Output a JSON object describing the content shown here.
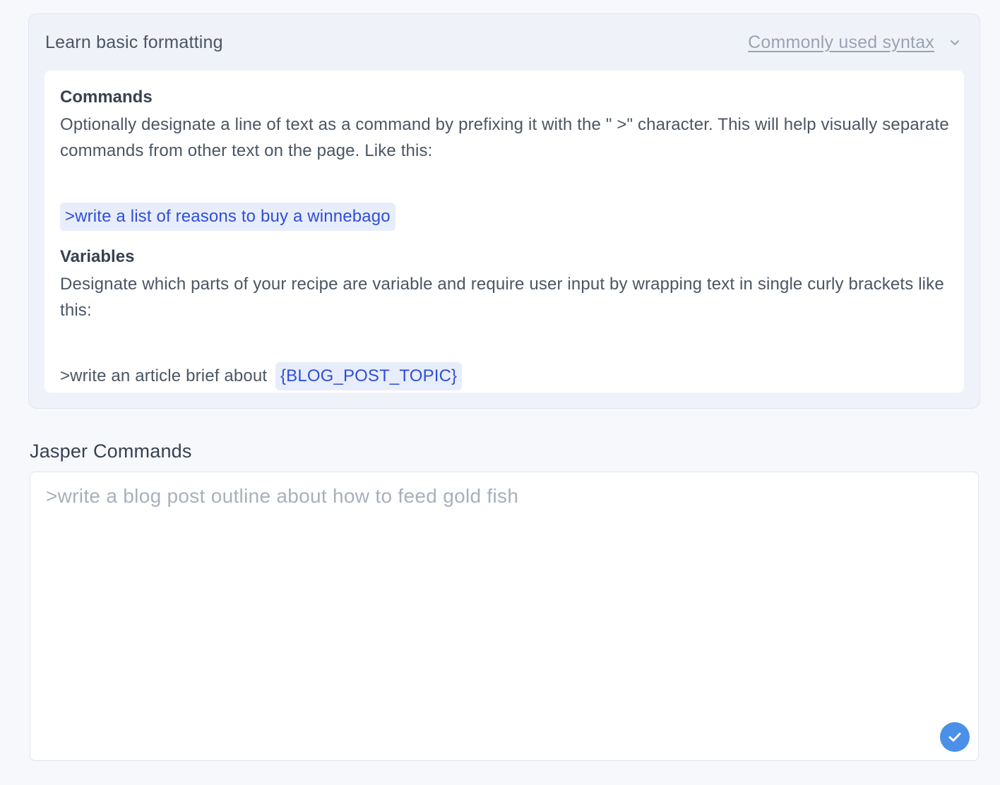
{
  "format_panel": {
    "title": "Learn basic formatting",
    "syntax_link": "Commonly used syntax",
    "toggle_icon": "chevron-down-icon",
    "commands": {
      "heading": "Commands",
      "description": "Optionally designate a line of text as a command by prefixing it with the \" >\" character. This will help visually separate commands from other text on the page. Like this:",
      "example": ">write a list of reasons to buy a winnebago"
    },
    "variables": {
      "heading": "Variables",
      "description": "Designate which parts of your recipe are variable and require user input by wrapping text in single curly brackets like this:",
      "example_prefix": ">write an article brief about",
      "example_variable": "{BLOG_POST_TOPIC}"
    }
  },
  "jasper_commands": {
    "label": "Jasper Commands",
    "placeholder": ">write a blog post outline about how to feed gold fish",
    "value": "",
    "status_icon": "check-circle-icon"
  },
  "colors": {
    "accent": "#2f4fd8",
    "chip_background": "#e8edfb",
    "check_badge": "#4a8fe8"
  }
}
